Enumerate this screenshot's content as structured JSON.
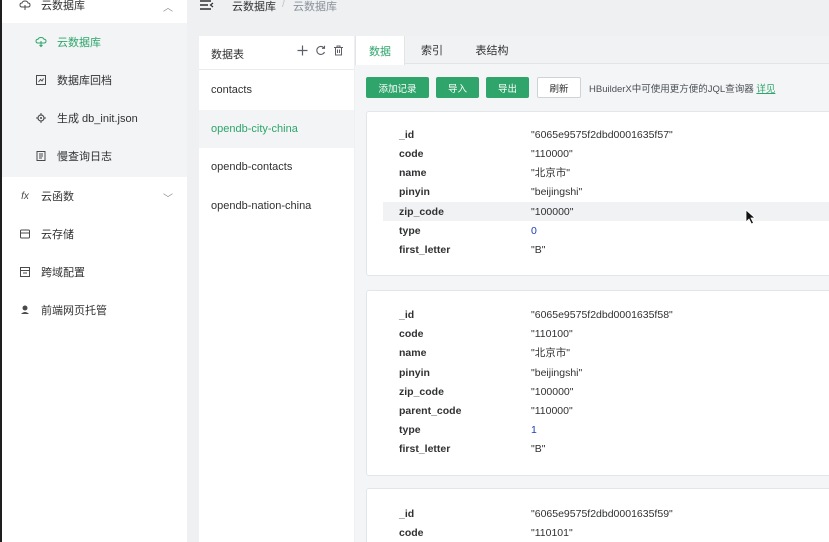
{
  "sidebar": {
    "group_title": "云数据库",
    "sub_items": [
      {
        "label": "云数据库",
        "icon": "database-icon",
        "active": true
      },
      {
        "label": "数据库回档",
        "icon": "restore-icon"
      },
      {
        "label": "生成 db_init.json",
        "icon": "generate-icon"
      },
      {
        "label": "慢查询日志",
        "icon": "log-icon"
      }
    ],
    "items": [
      {
        "label": "云函数",
        "icon": "function-icon",
        "glyph": "fx"
      },
      {
        "label": "云存储",
        "icon": "storage-icon"
      },
      {
        "label": "跨域配置",
        "icon": "cors-icon"
      },
      {
        "label": "前端网页托管",
        "icon": "hosting-icon"
      }
    ]
  },
  "breadcrumb": {
    "home": "云数据库",
    "sep": "/",
    "current": "云数据库"
  },
  "table_panel": {
    "title": "数据表",
    "tables": [
      "contacts",
      "opendb-city-china",
      "opendb-contacts",
      "opendb-nation-china"
    ],
    "active_index": 1
  },
  "tabs": [
    "数据",
    "索引",
    "表结构"
  ],
  "toolbar": {
    "add_label": "添加记录",
    "import_label": "导入",
    "export_label": "导出",
    "refresh_label": "刷新",
    "hint_text": "HBuilderX中可使用更方便的JQL查询器",
    "hint_link": "详见"
  },
  "records": [
    {
      "fields": [
        {
          "key": "_id",
          "value": "\"6065e9575f2dbd0001635f57\""
        },
        {
          "key": "code",
          "value": "\"110000\""
        },
        {
          "key": "name",
          "value": "\"北京市\""
        },
        {
          "key": "pinyin",
          "value": "\"beijingshi\""
        },
        {
          "key": "zip_code",
          "value": "\"100000\"",
          "highlight": true
        },
        {
          "key": "type",
          "value": "0",
          "numeric": true
        },
        {
          "key": "first_letter",
          "value": "\"B\""
        }
      ]
    },
    {
      "fields": [
        {
          "key": "_id",
          "value": "\"6065e9575f2dbd0001635f58\""
        },
        {
          "key": "code",
          "value": "\"110100\""
        },
        {
          "key": "name",
          "value": "\"北京市\""
        },
        {
          "key": "pinyin",
          "value": "\"beijingshi\""
        },
        {
          "key": "zip_code",
          "value": "\"100000\""
        },
        {
          "key": "parent_code",
          "value": "\"110000\""
        },
        {
          "key": "type",
          "value": "1",
          "numeric": true
        },
        {
          "key": "first_letter",
          "value": "\"B\""
        }
      ]
    },
    {
      "fields": [
        {
          "key": "_id",
          "value": "\"6065e9575f2dbd0001635f59\""
        },
        {
          "key": "code",
          "value": "\"110101\""
        }
      ]
    }
  ],
  "colors": {
    "accent": "#2fa56c",
    "number": "#1a3fb8"
  }
}
